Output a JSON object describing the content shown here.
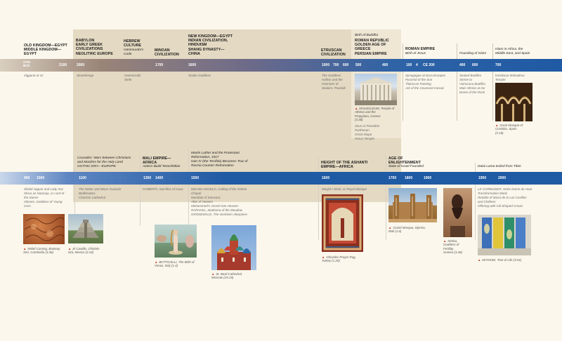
{
  "top": {
    "eras": [
      {
        "lines": "OLD KINGDOM—EGYPT\nMIDDLE KINGDOM—\nEGYPT"
      },
      {
        "lines": "BABYLON\nEARLY GREEK\nCIVILIZATIONS\nNEOLITHIC EUROPE"
      },
      {
        "lines": "HEBREW\nCULTURE"
      },
      {
        "lines": "MINOAN\nCIVILIZATION"
      },
      {
        "lines": "NEW KINGDOM—EGYPT\nINDIAN CIVILIZATION,\nHINDUISM\nSHANG DYNASTY—\nCHINA"
      },
      {
        "lines": "ETRUSCAN\nCIVILIZATION"
      },
      {
        "lines": "ROMAN REPUBLIC\nGOLDEN AGE OF\nGREECE\nPERSIAN EMPIRE"
      },
      {
        "lines": "ROMAN EMPIRE"
      }
    ],
    "subs": {
      "hammurabi": "Hammurabi's\nCode",
      "buddha": "Birth of Buddha",
      "jesus": "Birth of Jesus",
      "islam": "Founding of Islam",
      "africa": "Islam in Africa, the\nMiddle East, and Spain"
    },
    "years": [
      "2700\nBCE",
      "2100",
      "2000",
      "1700",
      "1600",
      "1000",
      "700",
      "600",
      "500",
      "400",
      "100",
      "4",
      "CE 200",
      "400",
      "600",
      "700"
    ],
    "notes": {
      "ziggurat": "Ziggurat at Ur",
      "stonehenge": "Stonehenge",
      "hammurabi_stele": "Hammurabi\nStele",
      "snake": "Snake Goddess",
      "hathor": "The Goddess\nHathor and the\nOverseer of\nSealers, Psamtik",
      "rome": "Synagogue at Dura-Europos\nPyramid of the Sun\nTlaloccan Painting\nArk of the Covenant mosaic",
      "buddha_notes": "Seated Buddha\nShrine to\nVairocana Buddha\nMain Shrine at Ise\nDome of the Rock",
      "kandariya": "Kandarya Mahadeva\nTemple",
      "greece_notes": "Zeus or Poseidon\nParthenon\nGreat Stupa\nHorus Temple"
    },
    "captions": {
      "temple": "MAUSOLEUM, Temple of\nAthena and the\nPropylaea, Greece\n(3.36)",
      "mosque": "Great Mosque of\nCordoba, Spain\n(2.16)"
    }
  },
  "bottom": {
    "subs": {
      "crusades": "Crusades: Wars between Christians\nand Muslims for the Holy Land\nGOTHIC ERA—EUROPE",
      "mali_sub": "Aztecs Build Tenochtitlan",
      "luther": "Martin Luther and the Protestant\nReformation, 1517\nIvan IV (the Terrible) Becomes Tsar of\nRussia Counter-Reformation",
      "israel": "State of Israel Founded",
      "dalai": "Dalai Lama Exiled from Tibet"
    },
    "eras": {
      "mali": "MALI EMPIRE—\nAFRICA",
      "ashanti": "HEIGHT OF THE ASHANTI\nEMPIRE—AFRICA",
      "enlight": "AGE OF\nENLIGHTENMENT"
    },
    "years": [
      "900",
      "1000",
      "1100",
      "1300",
      "1400",
      "1500",
      "1600",
      "1700",
      "1800",
      "1900",
      "1950",
      "2000"
    ],
    "notes": {
      "shield": "Shield Jaguar and Lady Xoc\nShiva as Nataraja, or Lord of\nthe Dance\nXilonen, Goddess of Young\nCorn",
      "guanyin": "The Water and Moon Guanyin\nBodhisattva\nChartres Cathedral",
      "isaac": "GHIBERTI, Sacrifice of Isaac",
      "sistine": "MICHELANGELO, Ceiling of the Sistine\nChapel\nMandala of Samvara\nAltar of Heaven\nMohammed's Ascent into Heaven\nRAPHAEL, Madonna of the Meadow\nGRÜNEWALD, The Isenheim Altarpiece",
      "masjid": "Masjid-i-Shah, or Royal Mosque",
      "ronchamp": "LE CORBUSIER, Notre Dame du Haut\nTransformation Mask\nRetablo of Maria de la Luz Casillas\nand Children\nOffering with Cili-Shaped Crown"
    },
    "captions": {
      "relief": "Relief Carving, Banteay\nSrei, Cambodia (3.36)",
      "castillo": "El Castillo, Chichén\nItzá, Mexico (2.34)",
      "venus": "BOTTICELLI, The Birth of\nVenus, Italy (1.4)",
      "basil": "St. Basil Cathedral,\nMoscow (15.15)",
      "rug": "Ghiordes Prayer Rug,\nTurkey (1.20)",
      "djenne": "Grand Mosque, Djenne,\nMali (1.6)",
      "nimba": "Nimba,\nGoddess of\nFertility,\nGuinea (3.46)",
      "tree": "MATISSE, Tree of Life (3.51)"
    }
  }
}
